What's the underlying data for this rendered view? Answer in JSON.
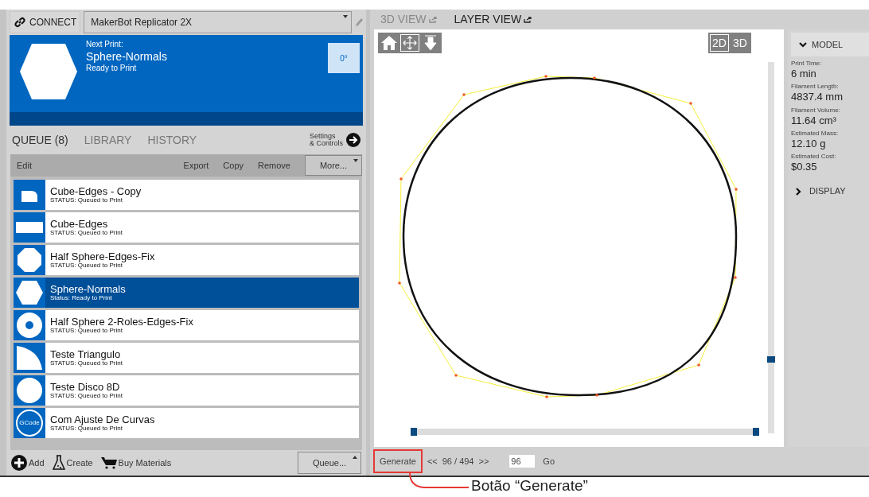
{
  "printer": {
    "connect_label": "CONNECT",
    "selected_printer": "MakerBot Replicator 2X"
  },
  "next_print": {
    "label": "Next Print:",
    "name": "Sphere-Normals",
    "status": "Ready to Print",
    "rotation": "0°"
  },
  "tabs": [
    {
      "label": "QUEUE (8)",
      "selected": true
    },
    {
      "label": "LIBRARY",
      "selected": false
    },
    {
      "label": "HISTORY",
      "selected": false
    }
  ],
  "settings_link": {
    "line_1": "Settings",
    "line_2": "& Controls"
  },
  "toolbar": {
    "left": "Edit",
    "actions": [
      "Export",
      "Copy",
      "Remove"
    ],
    "more": "More..."
  },
  "queue": [
    {
      "name": "Cube-Edges - Copy",
      "status": "STATUS: Queued to Print",
      "kind": "rounded-rect",
      "selected": false
    },
    {
      "name": "Cube-Edges",
      "status": "STATUS: Queued to Print",
      "kind": "rect",
      "selected": false
    },
    {
      "name": "Half Sphere-Edges-Fix",
      "status": "STATUS: Queued to Print",
      "kind": "octagon",
      "selected": false
    },
    {
      "name": "Sphere-Normals",
      "status": "Status: Ready to Print",
      "kind": "hexagon",
      "selected": true
    },
    {
      "name": "Half Sphere 2-Roles-Edges-Fix",
      "status": "STATUS: Queued to Print",
      "kind": "ring",
      "selected": false
    },
    {
      "name": "Teste Triangulo",
      "status": "STATUS: Queued to Print",
      "kind": "quarter",
      "selected": false
    },
    {
      "name": "Teste Disco 8D",
      "status": "STATUS: Queued to Print",
      "kind": "circle",
      "selected": false
    },
    {
      "name": "Com Ajuste De Curvas",
      "status": "STATUS: Queued to Print",
      "kind": "gcode",
      "thumb_label": "GCode",
      "selected": false
    }
  ],
  "bottom_actions": [
    {
      "label": "Add",
      "kind": "add"
    },
    {
      "label": "Create",
      "kind": "flask"
    },
    {
      "label": "Buy Materials",
      "kind": "cart"
    }
  ],
  "queue_menu": "Queue...",
  "view_tabs": [
    {
      "label": "3D VIEW",
      "selected": false
    },
    {
      "label": "LAYER VIEW",
      "selected": true
    }
  ],
  "view_modes": [
    {
      "label": "2D",
      "selected": true
    },
    {
      "label": "3D",
      "selected": false
    }
  ],
  "layer_slider": {
    "level": 0.2
  },
  "range_slider": {
    "start": {
      "level": 0
    },
    "end": {
      "level": 1
    }
  },
  "model_panel": {
    "header": "MODEL",
    "stats": [
      {
        "label": "Print Time:",
        "value": "6 min"
      },
      {
        "label": "Filament Length:",
        "value": "4837.4 mm"
      },
      {
        "label": "Filament Volume:",
        "value": "11.64 cm³"
      },
      {
        "label": "Estimated Mass:",
        "value": "12.10 g"
      },
      {
        "label": "Estimated Cost:",
        "value": "$0.35"
      }
    ],
    "display": "DISPLAY"
  },
  "layer_nav": {
    "generate": "Generate",
    "prev": "<<",
    "position": "96 / 494",
    "next": ">>",
    "layer_input": "96",
    "go": "Go"
  },
  "annotation": "Botão “Generate”"
}
